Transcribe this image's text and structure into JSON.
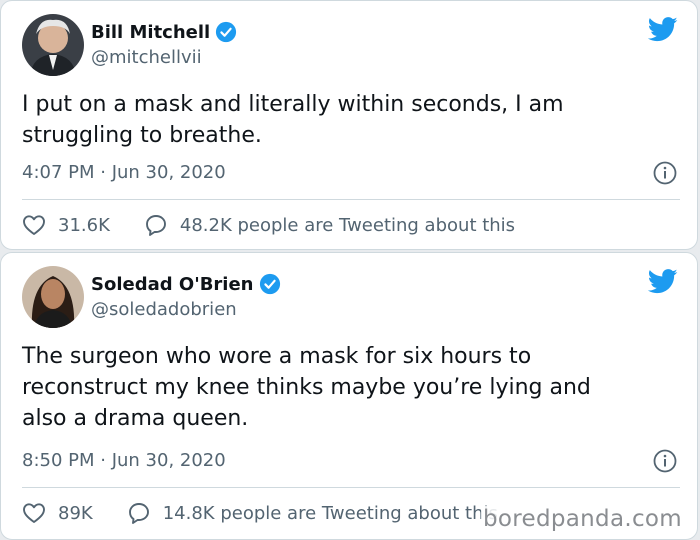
{
  "tweets": [
    {
      "author_name": "Bill Mitchell",
      "handle": "@mitchellvii",
      "verified": true,
      "text": "I put on a mask and literally within seconds, I am\nstruggling to breathe.",
      "timestamp": "4:07 PM · Jun 30, 2020",
      "likes": "31.6K",
      "conversation": "48.2K people are Tweeting about this"
    },
    {
      "author_name": "Soledad O'Brien",
      "handle": "@soledadobrien",
      "verified": true,
      "text": "The surgeon who wore a mask for six hours to\nreconstruct my knee thinks maybe you’re lying and\nalso a drama queen.",
      "timestamp": "8:50 PM · Jun 30, 2020",
      "likes": "89K",
      "conversation": "14.8K people are Tweeting about this"
    }
  ],
  "watermark": "boredpanda.com",
  "colors": {
    "twitter_blue": "#1d9bf0",
    "text_primary": "#0f1419",
    "text_secondary": "#536471",
    "border": "#cfd9de"
  },
  "icons": [
    "twitter-bird-icon",
    "verified-badge-icon",
    "info-icon",
    "heart-icon",
    "speech-bubble-icon"
  ]
}
